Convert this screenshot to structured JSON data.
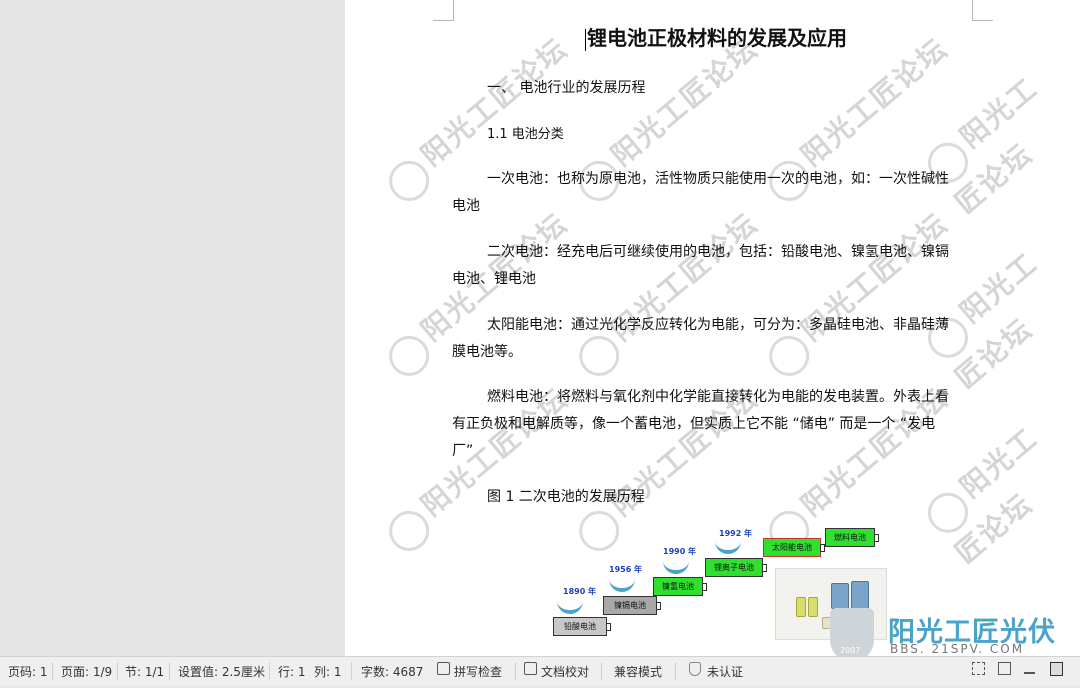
{
  "document": {
    "title": "锂电池正极材料的发展及应用",
    "lines": [
      "一、  电池行业的发展历程",
      "1.1  电池分类",
      "一次电池：也称为原电池，活性物质只能使用一次的电池，如：一次性碱性",
      "电池",
      "二次电池：经充电后可继续使用的电池，包括：铅酸电池、镍氢电池、镍镉",
      "电池、锂电池",
      "太阳能电池：通过光化学反应转化为电能，可分为：多晶硅电池、非晶硅薄",
      "膜电池等。",
      "燃料电池：将燃料与氧化剂中化学能直接转化为电能的发电装置。外表上看",
      "有正负极和电解质等，像一个蓄电池，但实质上它不能 “储电” 而是一个 “发电",
      "厂”",
      "图 1  二次电池的发展历程"
    ]
  },
  "figure": {
    "steps": [
      {
        "label": "铅酸电池",
        "color": "#c8c8c8"
      },
      {
        "label": "镍镉电池",
        "color": "#a8a8a8"
      },
      {
        "label": "镍氢电池",
        "color": "#2fe02f"
      },
      {
        "label": "锂离子电池",
        "color": "#2fe02f"
      },
      {
        "label": "太阳能电池",
        "color": "#2fe02f"
      },
      {
        "label": "燃料电池",
        "color": "#2fe02f"
      }
    ],
    "years": [
      "1890 年",
      "1956 年",
      "1990 年",
      "1992 年"
    ]
  },
  "watermark": {
    "text": "阳光工匠论坛",
    "sub": "BBS.21SPV.COM"
  },
  "logo": {
    "text": "阳光工匠光伏论坛",
    "sub": "BBS. 21SPV. COM",
    "year": "2007"
  },
  "statusbar": {
    "page_code": "页码: 1",
    "page": "页面: 1/9",
    "section": "节: 1/1",
    "setting": "设置值: 2.5厘米",
    "row": "行: 1",
    "col": "列: 1",
    "word_count": "字数: 4687",
    "spell_check": "拼写检查",
    "doc_compare": "文档校对",
    "compat_mode": "兼容模式",
    "not_certified": "未认证"
  },
  "colors": {
    "accent": "#4aa3c8",
    "green_box": "#2fe02f",
    "year_text": "#1f3fbf"
  }
}
